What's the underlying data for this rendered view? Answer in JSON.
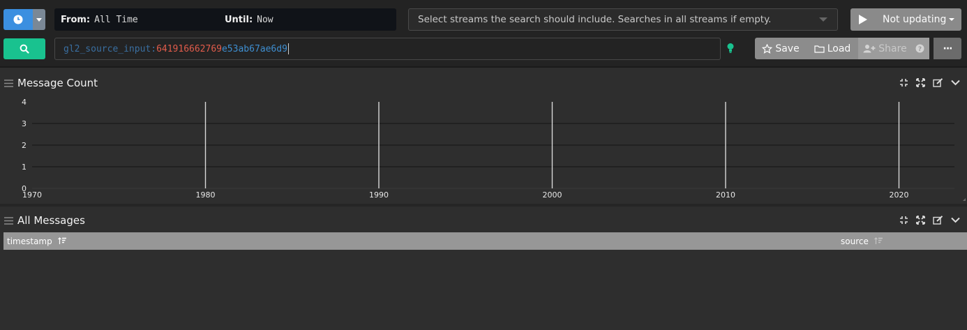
{
  "search_bar": {
    "from_label": "From:",
    "from_value": "All Time",
    "until_label": "Until:",
    "until_value": "Now",
    "streams_placeholder": "Select streams the search should include. Searches in all streams if empty.",
    "refresh_label": "Not updating",
    "query_field": "gl2_source_input:",
    "query_value_num": "641916662769",
    "query_value_hash": "e53ab67ae6d9"
  },
  "toolbar": {
    "save_label": "Save",
    "load_label": "Load",
    "share_label": "Share",
    "more_label": "···"
  },
  "widgets": {
    "message_count_title": "Message Count",
    "all_messages_title": "All Messages"
  },
  "table": {
    "columns": [
      "timestamp",
      "source"
    ]
  },
  "chart_data": {
    "type": "bar",
    "title": "Message Count",
    "x_ticks": [
      "1970",
      "1980",
      "1990",
      "2000",
      "2010",
      "2020"
    ],
    "y_ticks": [
      "0",
      "1",
      "2",
      "3",
      "4"
    ],
    "ylim": [
      0,
      4
    ],
    "bars": [
      {
        "x": 1980,
        "value": 4
      },
      {
        "x": 1990,
        "value": 4
      },
      {
        "x": 2000,
        "value": 4
      },
      {
        "x": 2010,
        "value": 4
      },
      {
        "x": 2020,
        "value": 4
      }
    ]
  },
  "colors": {
    "primary": "#3b8fe0",
    "search": "#19c28f",
    "query_number": "#e15c4b",
    "query_hash": "#3e8ed0"
  }
}
